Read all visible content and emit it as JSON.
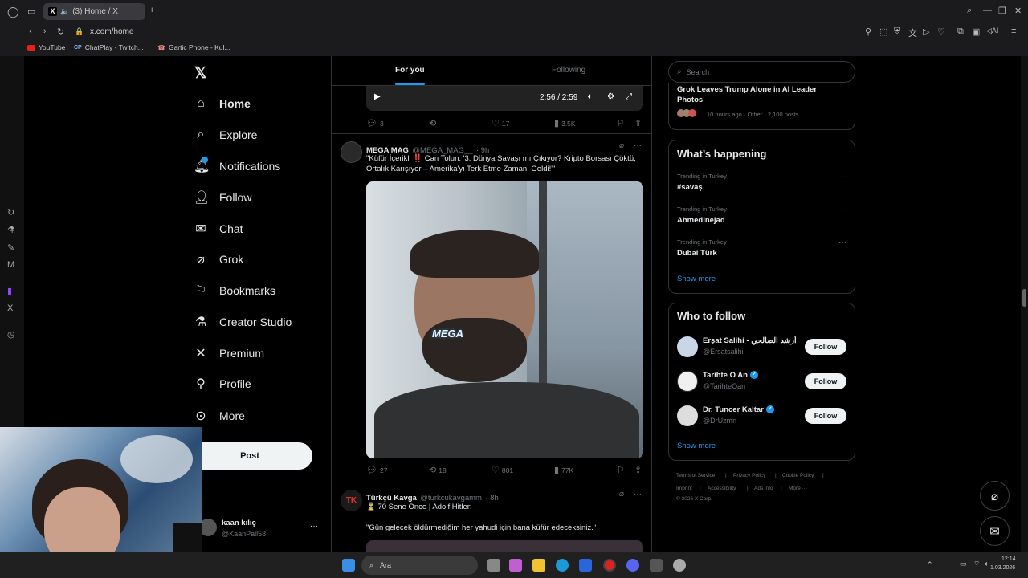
{
  "browser": {
    "tab_title": "(3) Home / X",
    "url": "x.com/home",
    "bookmarks": [
      "YouTube",
      "ChatPlay - Twitch...",
      "Gartic Phone - Kul..."
    ]
  },
  "nav": {
    "items": [
      {
        "label": "Home",
        "icon": "home-icon"
      },
      {
        "label": "Explore",
        "icon": "search-icon"
      },
      {
        "label": "Notifications",
        "icon": "bell-icon"
      },
      {
        "label": "Follow",
        "icon": "person-plus-icon"
      },
      {
        "label": "Chat",
        "icon": "mail-icon"
      },
      {
        "label": "Grok",
        "icon": "grok-icon"
      },
      {
        "label": "Bookmarks",
        "icon": "bookmark-icon"
      },
      {
        "label": "Creator Studio",
        "icon": "flask-icon"
      },
      {
        "label": "Premium",
        "icon": "x-icon"
      },
      {
        "label": "Profile",
        "icon": "person-icon"
      },
      {
        "label": "More",
        "icon": "more-icon"
      }
    ],
    "post_label": "Post",
    "account": {
      "name": "kaan kılıç",
      "handle": "@KaanPall58"
    }
  },
  "feed": {
    "tabs": [
      "For you",
      "Following"
    ],
    "video_time": "2:56 / 2:59",
    "top_actions": {
      "replies": "3",
      "likes": "17",
      "views": "3.5K"
    },
    "tweet1": {
      "name": "MEGA MAG",
      "handle": "@MEGA_MAG__",
      "time": "· 9h",
      "text": "\"Küfür İçerikli ‼️ Can Tolun: '3. Dünya Savaşı mı Çıkıyor? Kripto Borsası Çöktü, Ortalık Karışıyor – Amerika'yı Terk Etme Zamanı Geldi!'\"",
      "video_logo": "MEGA",
      "actions": {
        "replies": "27",
        "reposts": "18",
        "likes": "801",
        "views": "77K"
      }
    },
    "tweet2": {
      "name": "Türkçü Kavga",
      "handle": "@turkcukavgamm",
      "time": "· 8h",
      "line1": "⏳ 70 Sene Önce | Adolf Hitler:",
      "line2": "\"Gün gelecek öldürmediğim her yahudi için bana küfür edeceksiniz.\""
    }
  },
  "right": {
    "search_placeholder": "Search",
    "top_story": {
      "title": "Grok Leaves Trump Alone in AI Leader Photos",
      "meta": "10 hours ago · Other · 2,100 posts"
    },
    "happening": {
      "title": "What’s happening",
      "trends": [
        {
          "context": "Trending in Turkey",
          "name": "#savaş"
        },
        {
          "context": "Trending in Turkey",
          "name": "Ahmedinejad"
        },
        {
          "context": "Trending in Turkey",
          "name": "Dubai Türk"
        }
      ],
      "show_more": "Show more"
    },
    "who_to_follow": {
      "title": "Who to follow",
      "users": [
        {
          "name": "Erşat Salihi - أرشد الصالحي",
          "handle": "@Ersatsalihi",
          "verified": false
        },
        {
          "name": "Tarihte O An",
          "handle": "@TarihteOan",
          "verified": true
        },
        {
          "name": "Dr. Tuncer Kaltar",
          "handle": "@DrUzmn",
          "verified": true
        }
      ],
      "follow_label": "Follow",
      "show_more": "Show more"
    },
    "footer": {
      "links": [
        "Terms of Service",
        "Privacy Policy",
        "Cookie Policy",
        "Imprint",
        "Accessibility",
        "Ads info",
        "More ···"
      ],
      "copyright": "© 2026 X Corp."
    }
  },
  "taskbar": {
    "search_placeholder": "Ara",
    "time": "12:14",
    "date": "1.03.2026"
  },
  "colors": {
    "accent": "#1d9bf0",
    "background": "#000000",
    "border": "#2f3336"
  }
}
